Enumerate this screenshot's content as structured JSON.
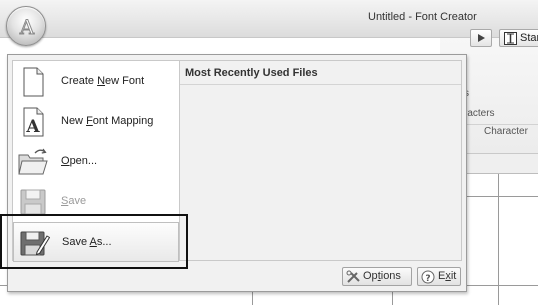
{
  "window": {
    "title": "Untitled - Font Creator"
  },
  "app_button": {
    "icon": "app-orb-icon"
  },
  "ribbon": {
    "start_label_partial": "Star",
    "line1_partial": "s",
    "line2_partial": "racters",
    "group_label_partial": "Character"
  },
  "app_menu": {
    "commands": [
      {
        "id": "create-new-font",
        "pre": "Create ",
        "key": "N",
        "post": "ew Font",
        "icon": "new-document-icon",
        "enabled": true
      },
      {
        "id": "new-font-mapping",
        "pre": "New ",
        "key": "F",
        "post": "ont Mapping",
        "icon": "font-mapping-icon",
        "enabled": true
      },
      {
        "id": "open",
        "pre": "",
        "key": "O",
        "post": "pen...",
        "icon": "open-folder-icon",
        "enabled": true
      },
      {
        "id": "save",
        "pre": "",
        "key": "S",
        "post": "ave",
        "icon": "save-disk-icon",
        "enabled": false
      },
      {
        "id": "save-as",
        "pre": "Save ",
        "key": "A",
        "post": "s...",
        "icon": "save-as-icon",
        "enabled": true,
        "selected": true
      }
    ],
    "mru": {
      "header": "Most Recently Used Files",
      "items": []
    },
    "footer": {
      "options": {
        "pre": "Op",
        "key": "t",
        "post": "ions",
        "icon": "options-icon"
      },
      "exit": {
        "pre": "E",
        "key": "x",
        "post": "it",
        "icon": "exit-icon"
      }
    }
  },
  "colors": {
    "menu_bg": "#f1f1f1",
    "pane_border": "#c9c9c9",
    "disabled_text": "#9a9a9a",
    "callout_border": "#111111"
  }
}
